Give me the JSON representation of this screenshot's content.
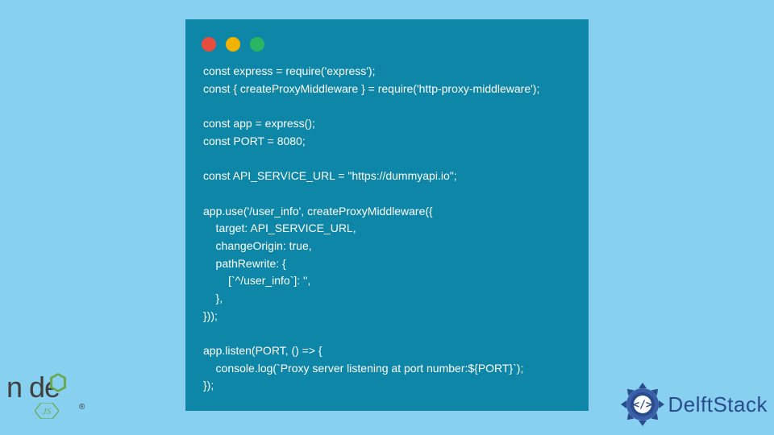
{
  "code": {
    "lines": [
      "const express = require('express');",
      "const { createProxyMiddleware } = require('http-proxy-middleware');",
      "",
      "const app = express();",
      "const PORT = 8080;",
      "",
      "const API_SERVICE_URL = \"https://dummyapi.io\";",
      "",
      "app.use('/user_info', createProxyMiddleware({",
      "    target: API_SERVICE_URL,",
      "    changeOrigin: true,",
      "    pathRewrite: {",
      "        [`^/user_info`]: '',",
      "    },",
      "}));",
      "",
      "app.listen(PORT, () => {",
      "    console.log(`Proxy server listening at port number:${PORT}`);",
      "});"
    ]
  },
  "logos": {
    "node": {
      "main": "n   de",
      "sub": "JS",
      "reg": "®"
    },
    "delft": {
      "text": "DelftStack"
    }
  },
  "colors": {
    "background": "#87d0f0",
    "window": "#0e86a8",
    "delft_blue": "#2b4c8c"
  }
}
